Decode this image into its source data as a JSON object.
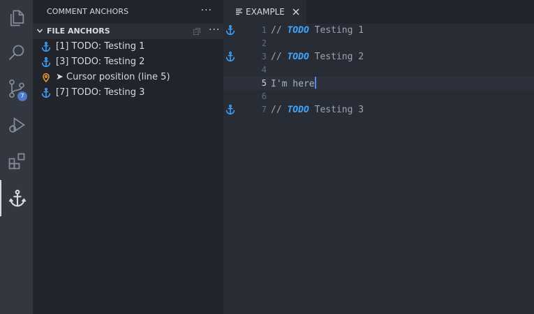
{
  "activity_bar": {
    "items": [
      {
        "icon": "files-icon"
      },
      {
        "icon": "search-icon"
      },
      {
        "icon": "source-control-icon",
        "badge": "7"
      },
      {
        "icon": "run-debug-icon"
      },
      {
        "icon": "extensions-icon"
      },
      {
        "icon": "anchor-icon",
        "active": true
      }
    ]
  },
  "sidebar": {
    "title": "COMMENT ANCHORS",
    "more": "···",
    "section": {
      "title": "FILE ANCHORS",
      "more": "···",
      "items": [
        {
          "label": "[1] TODO: Testing 1",
          "icon": "anchor-icon"
        },
        {
          "label": "[3] TODO: Testing 2",
          "icon": "anchor-icon"
        },
        {
          "label": "➤ Cursor position (line 5)",
          "icon": "location-pin-icon"
        },
        {
          "label": "[7] TODO: Testing 3",
          "icon": "anchor-icon"
        }
      ]
    }
  },
  "tab": {
    "label": "EXAMPLE",
    "close": "×"
  },
  "editor": {
    "lines": [
      {
        "number": "1",
        "anchor": true,
        "comment_prefix": "// ",
        "tag": "TODO",
        "rest": " Testing 1"
      },
      {
        "number": "2"
      },
      {
        "number": "3",
        "anchor": true,
        "comment_prefix": "// ",
        "tag": "TODO",
        "rest": " Testing 2"
      },
      {
        "number": "4"
      },
      {
        "number": "5",
        "text": "I'm here",
        "current": true
      },
      {
        "number": "6"
      },
      {
        "number": "7",
        "anchor": true,
        "comment_prefix": "// ",
        "tag": "TODO",
        "rest": " Testing 3"
      }
    ]
  },
  "colors": {
    "anchor": "#3ea6ff",
    "todo": "#3ea6ff",
    "pin": "#f0a030",
    "badge": "#4d78cc",
    "cursor": "#528bff"
  }
}
